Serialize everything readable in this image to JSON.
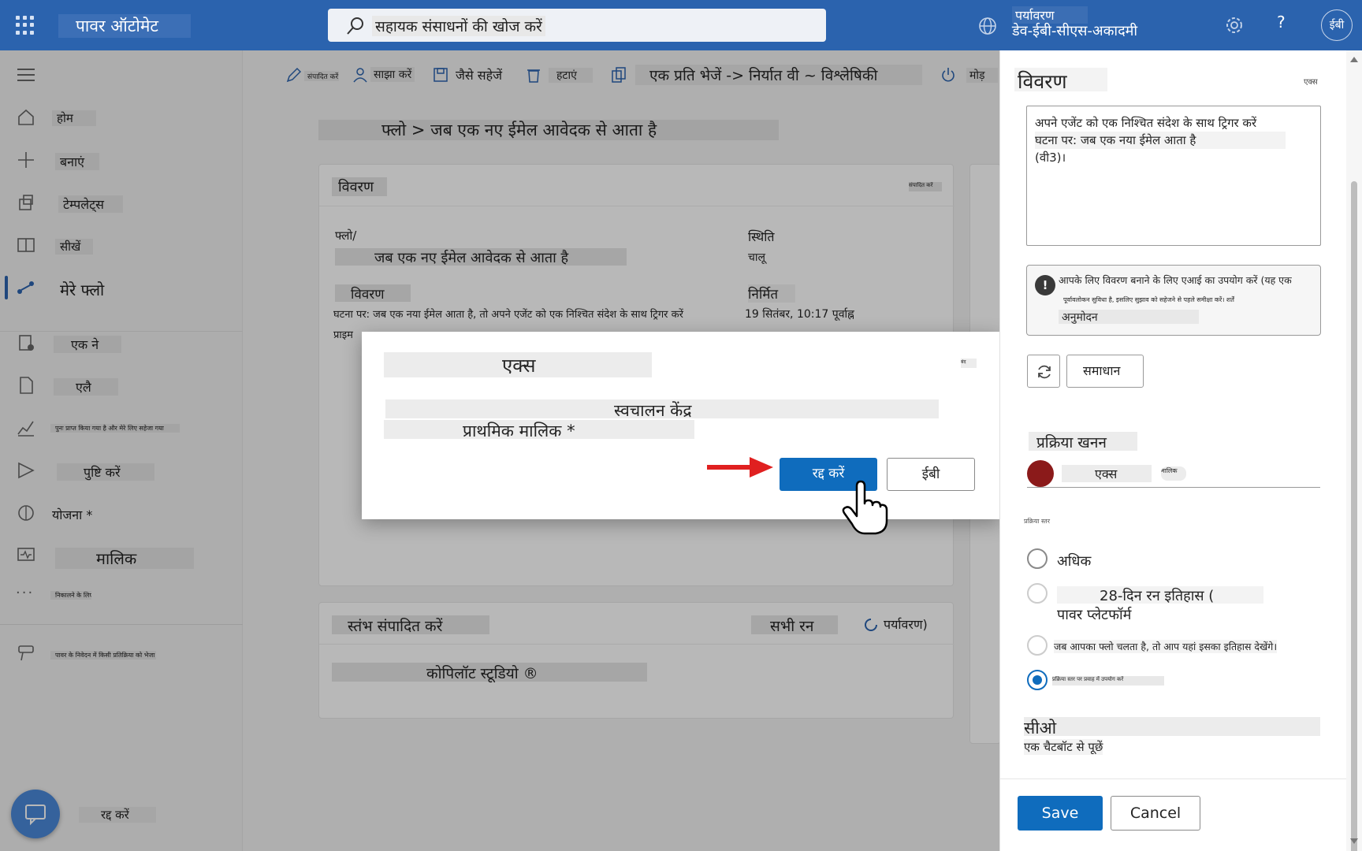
{
  "header": {
    "app_name": "पावर ऑटोमेट",
    "search_placeholder": "सहायक संसाधनों की खोज करें",
    "env_label": "पर्यावरण",
    "env_name": "डेव-ईबी-सीएस-अकादमी",
    "help": "?",
    "avatar": "ईबी"
  },
  "nav": {
    "home": "होम",
    "create": "बनाएं",
    "templates": "टेम्पलेट्स",
    "learn": "सीखें",
    "my_flows": "मेरे फ्लो",
    "item6": "एक ने",
    "item7": "एलै",
    "item8": "पुनः प्राप्त किया गया है और मेरे लिए सहेजा गया",
    "item9": "पुष्टि करें",
    "item10": "योजना *",
    "item11": "मालिक",
    "more": "निकालने के लिए",
    "bottom": "पावर के निवेदन में किसी प्रतिक्रिया को भेजा",
    "chat": "रद्द करें"
  },
  "toolbar": {
    "edit": "संपादित करें",
    "share": "साझा करें",
    "save_as": "जैसे सहेजें",
    "delete": "हटाएं",
    "export": "एक प्रति भेजें -> निर्यात वी ~ विश्लेषिकी",
    "turn": "मोड़"
  },
  "main": {
    "breadcrumb": "फ्लो > जब एक नए ईमेल आवेदक से आता है",
    "details_title": "विवरण",
    "details_edit": "संपादित करें",
    "flow_label": "फ्लो/",
    "flow_name": "जब एक नए ईमेल आवेदक से आता है",
    "status_label": "स्थिति",
    "status_value": "चालू",
    "desc_label": "विवरण",
    "desc_value": "घटना पर: जब एक नया ईमेल आता है, तो अपने एजेंट को एक निश्चित संदेश के साथ ट्रिगर करें",
    "desc_value2": "प्राइम",
    "created_label": "निर्मित",
    "created_value": "19 सितंबर, 10:17 पूर्वाह्न",
    "runs_title": "स्तंभ संपादित करें",
    "all_runs": "सभी रन",
    "refresh": "पर्यावरण)",
    "copilot": "कोपिलॉट स्टूडियो ®"
  },
  "dialog": {
    "title": "एक्स",
    "close": "बंद",
    "line1": "स्वचालन केंद्र",
    "line2": "प्राथमिक मालिक *",
    "primary_btn": "रद्द करें",
    "secondary_btn": "ईबी"
  },
  "panel": {
    "title": "विवरण",
    "close": "एक्स",
    "desc_line1": "अपने एजेंट को एक निश्चित संदेश के साथ ट्रिगर करें",
    "desc_line2": "घटना पर: जब एक नया ईमेल आता है",
    "desc_line3": "(वी3)।",
    "ai_line1": "आपके लिए विवरण बनाने के लिए एआई का उपयोग करें (यह एक",
    "ai_line2": "पूर्वावलोकन सुविधा है, इसलिए सुझाव को सहेजने से पहले समीक्षा करें। शर्तें",
    "ai_line3": "अनुमोदन",
    "solution_btn": "समाधान",
    "process_title": "प्रक्रिया खनन",
    "owner_name": "एक्स",
    "owner_tag": "मालिक",
    "radio_caption": "प्रक्रिया स्तर",
    "r1": "अधिक",
    "r2a": "28-दिन रन इतिहास (",
    "r2b": "पावर प्लेटफॉर्म",
    "r3": "जब आपका फ्लो चलता है, तो आप यहां इसका इतिहास देखेंगे।",
    "r4": "प्रक्रिया स्तर पर प्रवाह में उपयोग करें",
    "section": "सीओ",
    "ask": "एक चैटबॉट से पूछें",
    "save": "Save",
    "cancel": "Cancel"
  },
  "colors": {
    "brand": "#2b63ae",
    "primary": "#0f6cbd",
    "arrow": "#e02020"
  }
}
